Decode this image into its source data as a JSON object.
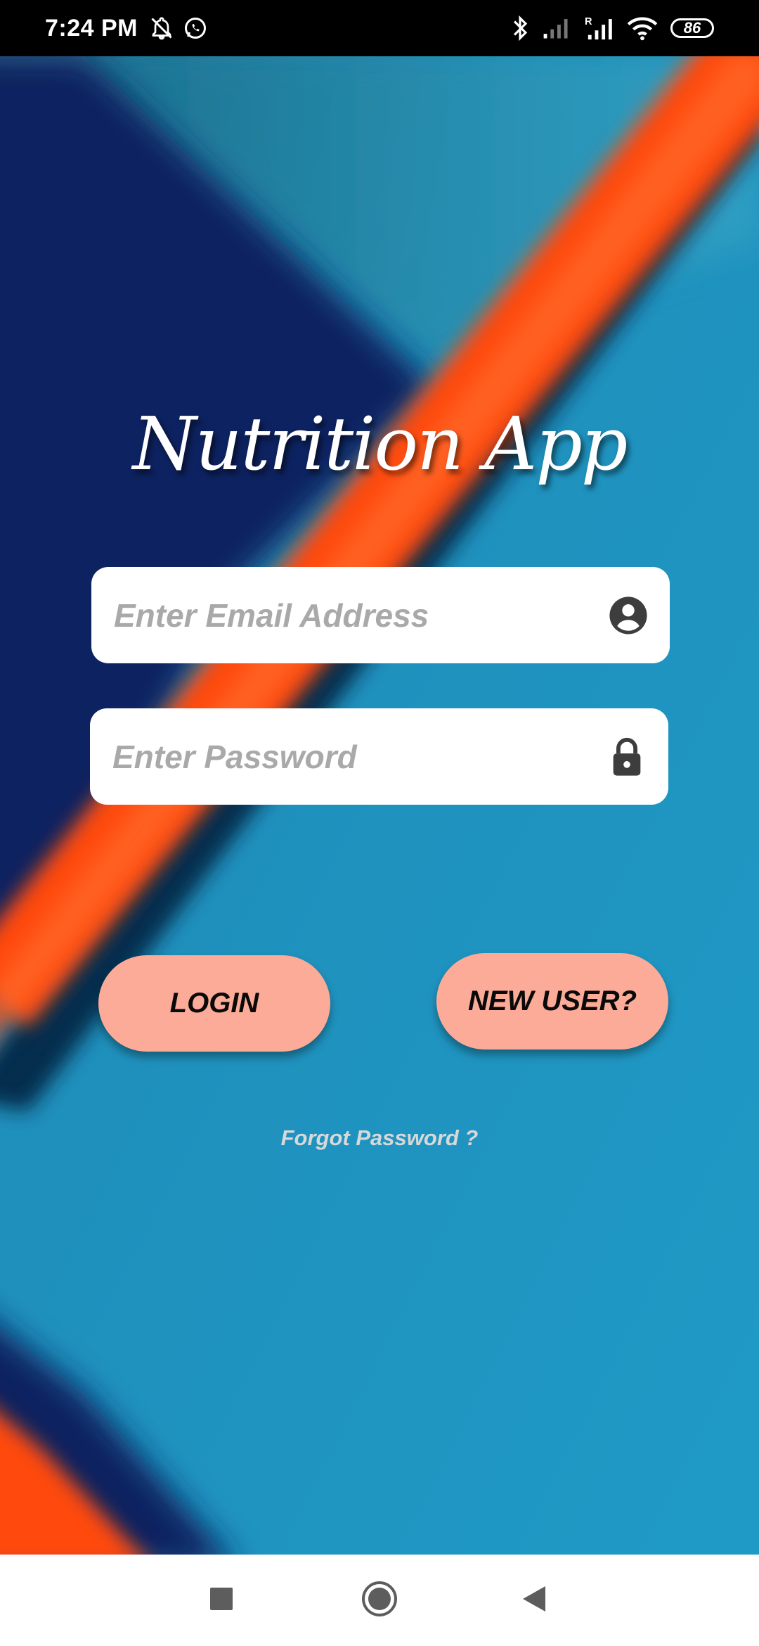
{
  "status_bar": {
    "time": "7:24 PM",
    "battery": "86",
    "icons": [
      "bell-off-icon",
      "whatsapp-icon",
      "bluetooth-icon",
      "signal-icon",
      "signal-roaming-icon",
      "wifi-icon"
    ]
  },
  "app": {
    "title": "Nutrition App"
  },
  "form": {
    "email_placeholder": "Enter Email Address",
    "password_placeholder": "Enter Password",
    "email_icon": "account-circle-icon",
    "password_icon": "lock-icon"
  },
  "actions": {
    "login_label": "LOGIN",
    "new_user_label": "NEW USER?",
    "forgot_label": "Forgot Password ?"
  },
  "nav": {
    "icons": [
      "recents-square-icon",
      "home-circle-icon",
      "back-triangle-icon"
    ]
  },
  "colors": {
    "background_blue": "#1f97c4",
    "navy": "#0a2a6a",
    "orange": "#ff4a10",
    "button": "#fbab97",
    "placeholder": "#a9a9a9"
  }
}
